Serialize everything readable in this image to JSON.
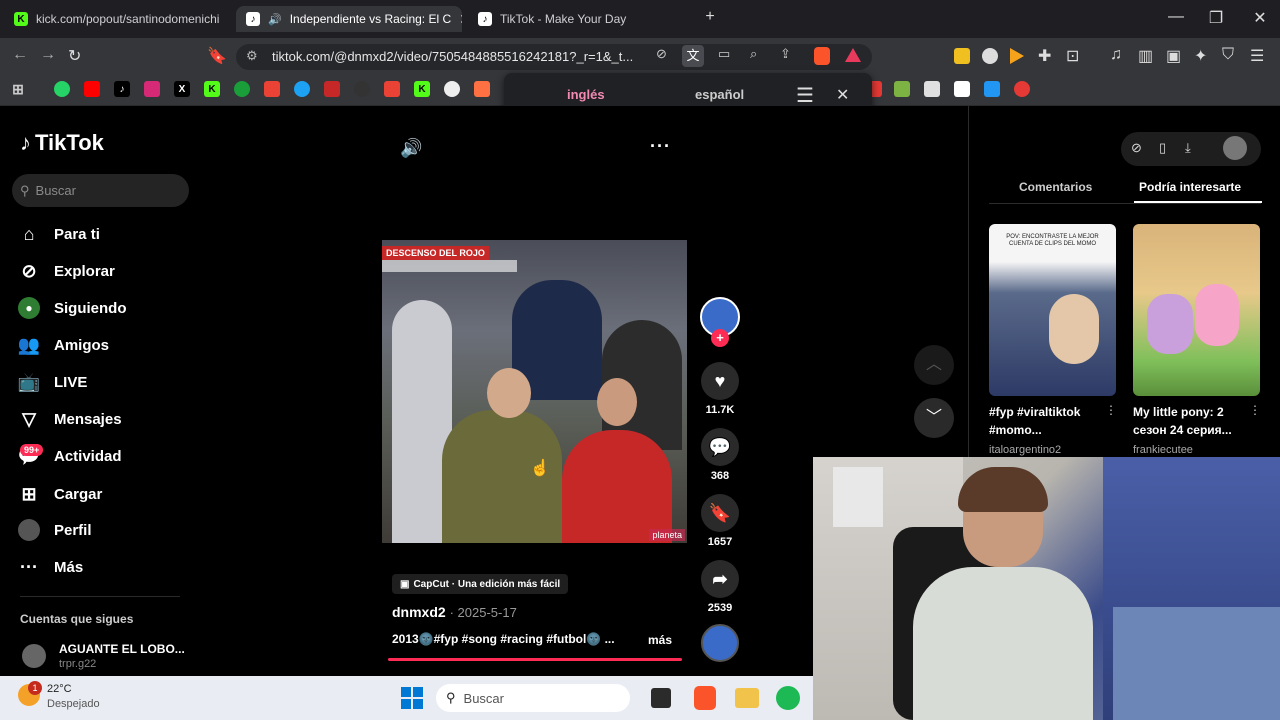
{
  "tabs": [
    {
      "title": "kick.com/popout/santinodomenichi",
      "icon": "K",
      "color": "#53fc18"
    },
    {
      "title": "Independiente vs Racing: El C",
      "icon": "♪",
      "color": "#000"
    },
    {
      "title": "TikTok - Make Your Day",
      "icon": "♪",
      "color": "#000"
    }
  ],
  "address": {
    "url": "tiktok.com/@dnmxd2/video/7505484885516242181?_r=1&_t..."
  },
  "translate": {
    "lang_from": "inglés",
    "lang_to": "español"
  },
  "tiktok": {
    "logo": "TikTok",
    "search_placeholder": "Buscar",
    "nav": [
      {
        "label": "Para ti",
        "icon": "home-icon"
      },
      {
        "label": "Explorar",
        "icon": "compass-icon"
      },
      {
        "label": "Siguiendo",
        "icon": "following-icon"
      },
      {
        "label": "Amigos",
        "icon": "friends-icon"
      },
      {
        "label": "LIVE",
        "icon": "live-icon"
      },
      {
        "label": "Mensajes",
        "icon": "message-icon"
      },
      {
        "label": "Actividad",
        "icon": "activity-icon",
        "badge": "99+"
      },
      {
        "label": "Cargar",
        "icon": "upload-icon"
      },
      {
        "label": "Perfil",
        "icon": "profile-icon"
      },
      {
        "label": "Más",
        "icon": "more-icon"
      }
    ],
    "following_title": "Cuentas que sigues",
    "following": [
      {
        "name": "AGUANTE EL LOBO...",
        "handle": "trpr.g22"
      }
    ],
    "video": {
      "overlay_text": "DESCENSO DEL ROJO",
      "watermark": "planeta",
      "capcut": "CapCut · Una edición más fácil",
      "author": "dnmxd2",
      "date": "2025-5-17",
      "caption": "2013🌚#fyp #song #racing #futbol🌚 ...",
      "more": "más"
    },
    "actions": {
      "likes": "11.7K",
      "comments": "368",
      "saves": "1657",
      "shares": "2539"
    },
    "right_tabs": [
      "Comentarios",
      "Podría interesarte"
    ],
    "recommendations": [
      {
        "title": "#fyp #viraltiktok #momo...",
        "author": "italoargentino2",
        "thumb_text": "POV: ENCONTRASTE LA MEJOR CUENTA DE CLIPS DEL MOMO"
      },
      {
        "title": "My little pony: 2 сезон 24 серия...",
        "author": "frankiecutee"
      }
    ]
  },
  "taskbar": {
    "weather_temp": "22°C",
    "weather_desc": "Despejado",
    "weather_badge": "1",
    "search": "Buscar"
  }
}
